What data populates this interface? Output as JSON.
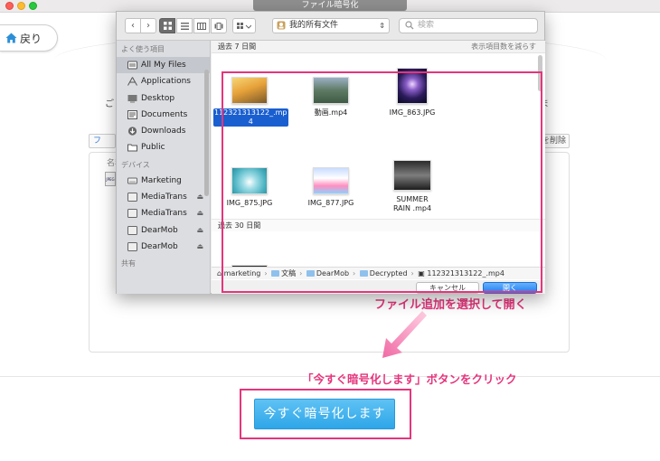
{
  "app": {
    "window_title": "ファイル暗号化",
    "back_label": "戻り",
    "frag_add": "フ",
    "frag_delete": "を削除",
    "frag_name": "名称",
    "frag_left": "ご",
    "frag_right": "ま",
    "frag_jpeg": "JPEG",
    "encrypt_button": "今すぐ暗号化します"
  },
  "annotations": {
    "open_hint": "ファイル追加を選択して開く",
    "encrypt_hint": "「今すぐ暗号化します」ボタンをクリック"
  },
  "dialog": {
    "location": "我的所有文件",
    "search_placeholder": "検索",
    "sidebar": {
      "favorites_header": "よく使う項目",
      "devices_header": "デバイス",
      "shared_header": "共有",
      "favorites": [
        {
          "label": "All My Files",
          "icon": "all-files-icon",
          "active": true
        },
        {
          "label": "Applications",
          "icon": "applications-icon"
        },
        {
          "label": "Desktop",
          "icon": "desktop-icon"
        },
        {
          "label": "Documents",
          "icon": "documents-icon"
        },
        {
          "label": "Downloads",
          "icon": "downloads-icon"
        },
        {
          "label": "Public",
          "icon": "folder-icon"
        }
      ],
      "devices": [
        {
          "label": "Marketing",
          "icon": "disk-icon"
        },
        {
          "label": "MediaTrans",
          "icon": "disk-icon",
          "eject": true
        },
        {
          "label": "MediaTrans",
          "icon": "disk-icon",
          "eject": true
        },
        {
          "label": "DearMob",
          "icon": "disk-icon",
          "eject": true
        },
        {
          "label": "DearMob",
          "icon": "disk-icon",
          "eject": true
        }
      ]
    },
    "section_recent": "過去 7 日間",
    "section_30days": "過去 30 日間",
    "show_less": "表示項目数を減らす",
    "files": [
      {
        "line1": "112321313122_.mp",
        "line2": "4",
        "selected": true,
        "thumb": "desert"
      },
      {
        "line1": "動画.mp4",
        "line2": "",
        "thumb": "city"
      },
      {
        "line1": "IMG_863.JPG",
        "line2": "",
        "thumb": "galaxy"
      },
      {
        "line1": "IMG_875.JPG",
        "line2": "",
        "thumb": "drop"
      },
      {
        "line1": "IMG_877.JPG",
        "line2": "",
        "thumb": "balloon"
      },
      {
        "line1": "SUMMER",
        "line2": "RAIN .mp4",
        "thumb": "summer"
      }
    ],
    "path": [
      "marketing",
      "文稿",
      "DearMob",
      "Decrypted",
      "112321313122_.mp4"
    ],
    "cancel_label": "キャンセル",
    "open_label": "開く"
  },
  "colors": {
    "accent_pink": "#e5357c",
    "encrypt_blue": "#2ea6e8",
    "open_blue": "#1d7ef5"
  }
}
